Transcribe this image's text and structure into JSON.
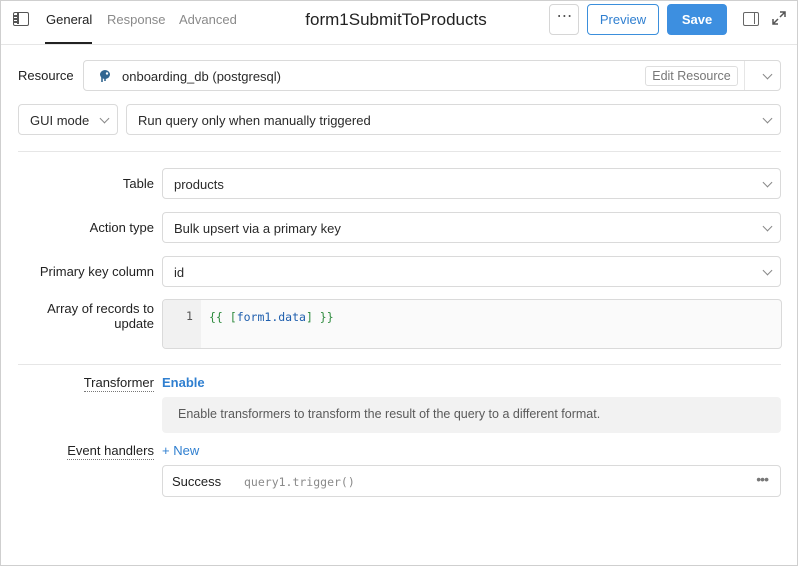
{
  "header": {
    "tabs": [
      {
        "label": "General",
        "active": true
      },
      {
        "label": "Response",
        "active": false
      },
      {
        "label": "Advanced",
        "active": false
      }
    ],
    "title": "form1SubmitToProducts",
    "more_label": "⋯",
    "preview_label": "Preview",
    "save_label": "Save"
  },
  "resource": {
    "label": "Resource",
    "value": "onboarding_db (postgresql)",
    "edit_label": "Edit Resource"
  },
  "mode": {
    "value": "GUI mode",
    "trigger": "Run query only when manually triggered"
  },
  "fields": {
    "table": {
      "label": "Table",
      "value": "products"
    },
    "action_type": {
      "label": "Action type",
      "value": "Bulk upsert via a primary key"
    },
    "primary_key": {
      "label": "Primary key column",
      "value": "id"
    },
    "records": {
      "label_line1": "Array of records to",
      "label_line2": "update",
      "line_number": "1",
      "code_open": "{{ [",
      "code_inner": "form1.data",
      "code_close": "] }}"
    }
  },
  "transformer": {
    "label": "Transformer",
    "enable_label": "Enable",
    "info": "Enable transformers to transform the result of the query to a different format."
  },
  "event_handlers": {
    "label": "Event handlers",
    "new_label": "+ New",
    "items": [
      {
        "event": "Success",
        "action": "query1.trigger()"
      }
    ]
  },
  "colors": {
    "accent": "#3d8fe0",
    "code_green": "#2e8b3e",
    "code_blue": "#1f5fae"
  }
}
